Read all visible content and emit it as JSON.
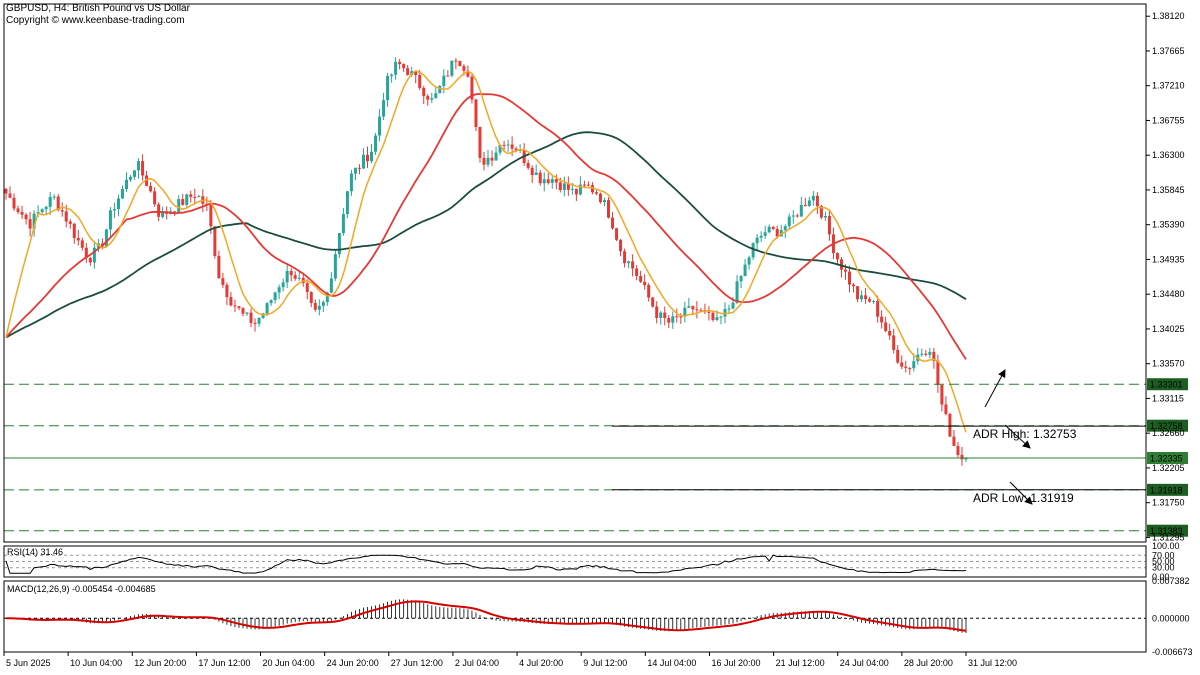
{
  "header": {
    "title": "GBPUSD, H4:  British Pound vs US Dollar",
    "copyright": "Copyright © www.keenbase-trading.com"
  },
  "colors": {
    "bull": "#26a69a",
    "bear": "#e53935",
    "ma_fast": "#f5a623",
    "ma_mid": "#e53935",
    "ma_slow": "#1b4d3e",
    "macd_signal": "#d50000",
    "hline": "#2e7d32"
  },
  "chart_data": [
    {
      "type": "candlestick",
      "symbol": "GBPUSD",
      "timeframe": "H4",
      "ylim": [
        1.31235,
        1.3828
      ],
      "y_ticks": [
        "1.38120",
        "1.37665",
        "1.37210",
        "1.36755",
        "1.36300",
        "1.35845",
        "1.35390",
        "1.34935",
        "1.34480",
        "1.34025",
        "1.33570",
        "1.33115",
        "1.32660",
        "1.32205",
        "1.31750",
        "1.31295"
      ],
      "x_labels": [
        "5 Jun 2025",
        "10 Jun 04:00",
        "12 Jun 20:00",
        "17 Jun 12:00",
        "20 Jun 04:00",
        "24 Jun 20:00",
        "27 Jun 12:00",
        "2 Jul 04:00",
        "4 Jul 20:00",
        "9 Jul 12:00",
        "14 Jul 04:00",
        "16 Jul 20:00",
        "21 Jul 12:00",
        "24 Jul 04:00",
        "28 Jul 20:00",
        "31 Jul 12:00"
      ],
      "close_path": [
        1.358,
        1.356,
        1.354,
        1.356,
        1.3575,
        1.355,
        1.352,
        1.3495,
        1.351,
        1.356,
        1.359,
        1.362,
        1.359,
        1.355,
        1.356,
        1.357,
        1.358,
        1.356,
        1.347,
        1.344,
        1.342,
        1.341,
        1.343,
        1.346,
        1.348,
        1.346,
        1.342,
        1.344,
        1.352,
        1.36,
        1.362,
        1.364,
        1.372,
        1.375,
        1.374,
        1.372,
        1.37,
        1.373,
        1.376,
        1.374,
        1.362,
        1.363,
        1.365,
        1.364,
        1.362,
        1.36,
        1.36,
        1.359,
        1.358,
        1.359,
        1.358,
        1.355,
        1.35,
        1.348,
        1.345,
        1.342,
        1.341,
        1.342,
        1.343,
        1.342,
        1.341,
        1.343,
        1.347,
        1.351,
        1.353,
        1.353,
        1.354,
        1.356,
        1.358,
        1.355,
        1.35,
        1.347,
        1.344,
        1.344,
        1.341,
        1.337,
        1.335,
        1.337,
        1.338,
        1.33,
        1.325,
        1.3225
      ],
      "horizontal_levels": [
        {
          "price": 1.33301,
          "label": "1.33301",
          "style": "dashed"
        },
        {
          "price": 1.32758,
          "label": "1.32758",
          "style": "dashed"
        },
        {
          "price": 1.32335,
          "label": "1.32335",
          "style": "solid",
          "current": true
        },
        {
          "price": 1.31918,
          "label": "1.31918",
          "style": "dashed"
        },
        {
          "price": 1.31383,
          "label": "1.31383",
          "style": "dashed"
        }
      ],
      "annotations": [
        {
          "text": "ADR High: 1.32753",
          "price": 1.32753
        },
        {
          "text": "ADR Low: 1.31919",
          "price": 1.31919
        }
      ]
    },
    {
      "type": "line",
      "indicator": "RSI",
      "title": "RSI(14) 31.46",
      "ylim": [
        0,
        100
      ],
      "y_ticks": [
        "100.00",
        "70.00",
        "50.00",
        "30.00",
        "0.00"
      ]
    },
    {
      "type": "histogram",
      "indicator": "MACD",
      "title": "MACD(12,26,9) -0.005454 -0.004685",
      "ylim": [
        -0.006673,
        0.007382
      ],
      "y_ticks": [
        "0.007382",
        "0.000000",
        "-0.006673"
      ]
    }
  ]
}
